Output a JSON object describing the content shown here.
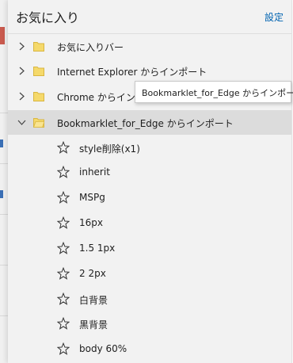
{
  "panel": {
    "title": "お気に入り",
    "settings_label": "設定"
  },
  "folders": [
    {
      "label": "お気に入りバー",
      "expanded": false
    },
    {
      "label": "Internet Explorer からインポート",
      "expanded": false
    },
    {
      "label": "Chrome からインポート",
      "expanded": false
    },
    {
      "label": "Bookmarklet_for_Edge からインポート",
      "expanded": true
    }
  ],
  "bookmarks": [
    {
      "label": "style削除(x1)"
    },
    {
      "label": "inherit"
    },
    {
      "label": "MSPg"
    },
    {
      "label": "16px"
    },
    {
      "label": "1.5 1px"
    },
    {
      "label": "2 2px"
    },
    {
      "label": "白背景"
    },
    {
      "label": "黒背景"
    },
    {
      "label": "body 60%"
    }
  ],
  "tooltip": {
    "text": "Bookmarklet_for_Edge からインポート"
  },
  "colors": {
    "accent": "#0063b1",
    "folder": "#f5d96b",
    "folder_outline": "#d9b640",
    "selected_row": "#dcdcdc"
  }
}
